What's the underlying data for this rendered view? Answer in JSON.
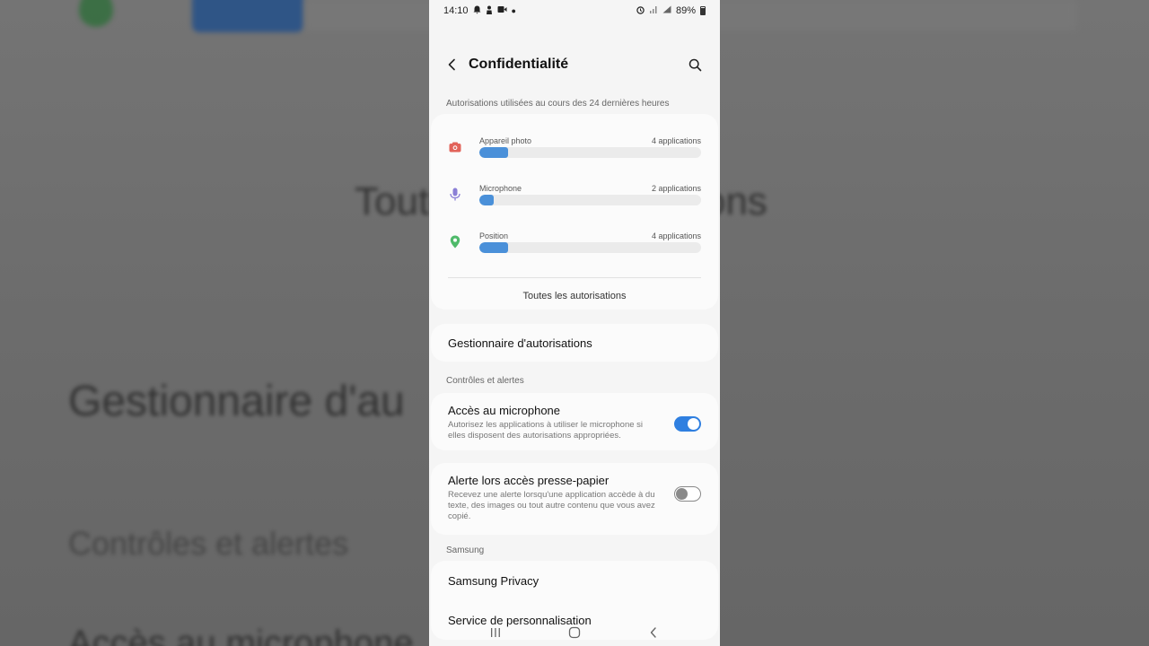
{
  "status_bar": {
    "time": "14:10",
    "battery": "89%",
    "icons": [
      "notification-icon",
      "person-icon",
      "video-icon",
      "dot-icon",
      "alarm-icon",
      "wifi-icon",
      "signal-icon",
      "battery-icon"
    ]
  },
  "background": {
    "text_1": "Toutes les autorisations",
    "text_2": "Gestionnaire d'au",
    "text_3": "Contrôles et alertes",
    "text_4": "Accès au microphone"
  },
  "header": {
    "title": "Confidentialité"
  },
  "usage": {
    "section_label": "Autorisations utilisées au cours des 24 dernières heures",
    "items": [
      {
        "label": "Appareil photo",
        "count": "4 applications",
        "icon": "camera-icon",
        "color": "#e2635a",
        "fraction": 0.13
      },
      {
        "label": "Microphone",
        "count": "2 applications",
        "icon": "microphone-icon",
        "color": "#8b7fd6",
        "fraction": 0.065
      },
      {
        "label": "Position",
        "count": "4 applications",
        "icon": "location-pin-icon",
        "color": "#4fba6a",
        "fraction": 0.13
      }
    ],
    "all_permissions": "Toutes les autorisations"
  },
  "permission_manager": "Gestionnaire d'autorisations",
  "controls": {
    "section_label": "Contrôles et alertes",
    "microphone_access": {
      "title": "Accès au microphone",
      "description": "Autorisez les applications à utiliser le microphone si elles disposent des autorisations appropriées.",
      "enabled": true
    },
    "clipboard_alert": {
      "title": "Alerte lors accès presse-papier",
      "description": "Recevez une alerte lorsqu'une application accède à du texte, des images ou tout autre contenu que vous avez copié.",
      "enabled": false
    }
  },
  "samsung": {
    "section_label": "Samsung",
    "items": [
      "Samsung Privacy",
      "Service de personnalisation"
    ]
  },
  "colors": {
    "accent": "#2f7fe0",
    "bar": "#4a90d9"
  }
}
